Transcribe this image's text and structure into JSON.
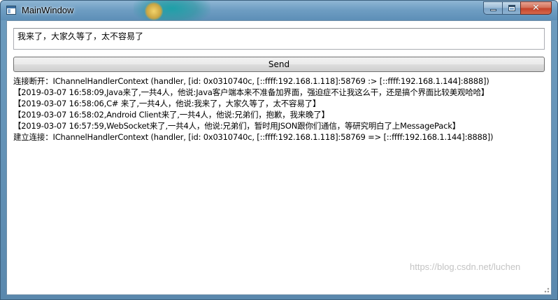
{
  "window": {
    "title": "MainWindow",
    "icon": "window-app-icon",
    "controls": {
      "minimize_icon": "minimize-icon",
      "maximize_icon": "maximize-icon",
      "close_icon": "close-icon",
      "close_glyph": "✕"
    },
    "colors": {
      "titlebar": "#6f9ec3",
      "close": "#c5432a"
    }
  },
  "input": {
    "value": "我来了，大家久等了，太不容易了"
  },
  "send": {
    "label": "Send"
  },
  "log": {
    "lines": [
      "连接断开：IChannelHandlerContext (handler, [id: 0x0310740c, [::ffff:192.168.1.118]:58769 :> [::ffff:192.168.1.144]:8888])",
      "【2019-03-07 16:58:09,Java来了,一共4人，他说:Java客户端本来不准备加界面，强迫症不让我这么干，还是搞个界面比较美观哈哈】",
      "【2019-03-07 16:58:06,C# 来了,一共4人，他说:我来了，大家久等了，太不容易了】",
      "【2019-03-07 16:58:02,Android Client来了,一共4人，他说:兄弟们，抱歉，我来晚了】",
      "【2019-03-07 16:57:59,WebSocket来了,一共4人，他说:兄弟们，暂时用JSON跟你们通信，等研究明白了上MessagePack】",
      "建立连接：IChannelHandlerContext (handler, [id: 0x0310740c, [::ffff:192.168.1.118]:58769 => [::ffff:192.168.1.144]:8888])"
    ]
  },
  "watermark": {
    "text": "https://blog.csdn.net/luchen"
  }
}
